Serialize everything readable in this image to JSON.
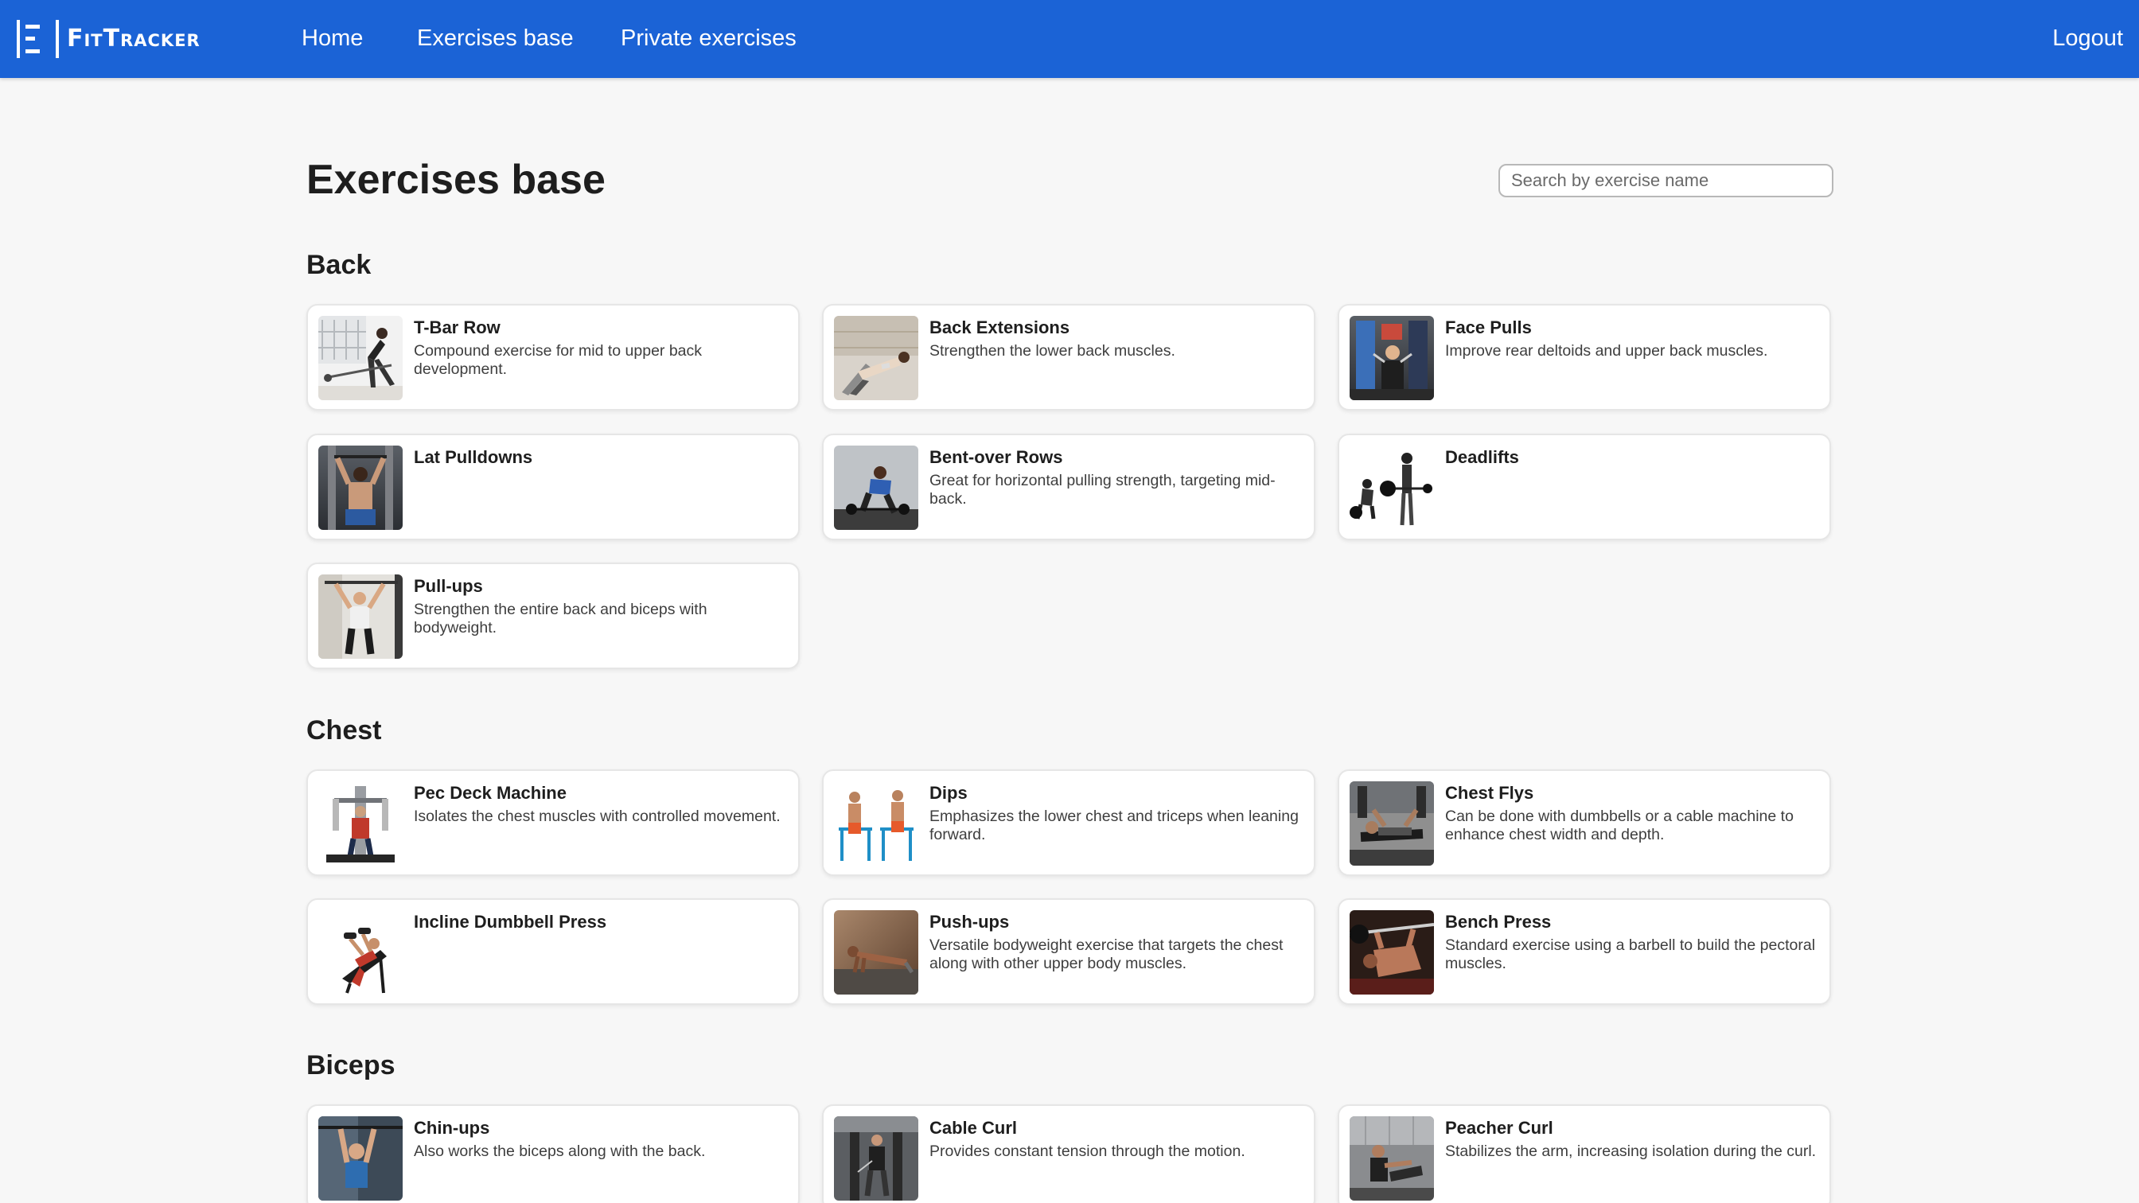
{
  "brand": {
    "logo_text": "FitTracker",
    "accent": "#1b63d6"
  },
  "nav": {
    "home": "Home",
    "exercises_base": "Exercises base",
    "private_exercises": "Private exercises",
    "logout": "Logout"
  },
  "page": {
    "title": "Exercises base",
    "search_placeholder": "Search by exercise name"
  },
  "sections": [
    {
      "title": "Back",
      "exercises": [
        {
          "name": "T-Bar Row",
          "description": "Compound exercise for mid to upper back development.",
          "image": "tbar-row-photo"
        },
        {
          "name": "Back Extensions",
          "description": "Strengthen the lower back muscles.",
          "image": "back-extensions-photo"
        },
        {
          "name": "Face Pulls",
          "description": "Improve rear deltoids and upper back muscles.",
          "image": "face-pulls-photo"
        },
        {
          "name": "Lat Pulldowns",
          "description": "",
          "image": "lat-pulldowns-photo"
        },
        {
          "name": "Bent-over Rows",
          "description": "Great for horizontal pulling strength, targeting mid-back.",
          "image": "bent-over-rows-photo"
        },
        {
          "name": "Deadlifts",
          "description": "",
          "image": "deadlifts-photo"
        },
        {
          "name": "Pull-ups",
          "description": "Strengthen the entire back and biceps with bodyweight.",
          "image": "pull-ups-photo"
        }
      ]
    },
    {
      "title": "Chest",
      "exercises": [
        {
          "name": "Pec Deck Machine",
          "description": "Isolates the chest muscles with controlled movement.",
          "image": "pec-deck-photo"
        },
        {
          "name": "Dips",
          "description": "Emphasizes the lower chest and triceps when leaning forward.",
          "image": "dips-photo"
        },
        {
          "name": "Chest Flys",
          "description": "Can be done with dumbbells or a cable machine to enhance chest width and depth.",
          "image": "chest-flys-photo"
        },
        {
          "name": "Incline Dumbbell Press",
          "description": "",
          "image": "incline-press-photo"
        },
        {
          "name": "Push-ups",
          "description": "Versatile bodyweight exercise that targets the chest along with other upper body muscles.",
          "image": "push-ups-photo"
        },
        {
          "name": "Bench Press",
          "description": "Standard exercise using a barbell to build the pectoral muscles.",
          "image": "bench-press-photo"
        }
      ]
    },
    {
      "title": "Biceps",
      "exercises": [
        {
          "name": "Chin-ups",
          "description": "Also works the biceps along with the back.",
          "image": "chin-ups-photo"
        },
        {
          "name": "Cable Curl",
          "description": "Provides constant tension through the motion.",
          "image": "cable-curl-photo"
        },
        {
          "name": "Peacher Curl",
          "description": "Stabilizes the arm, increasing isolation during the curl.",
          "image": "peacher-curl-photo"
        }
      ]
    }
  ]
}
